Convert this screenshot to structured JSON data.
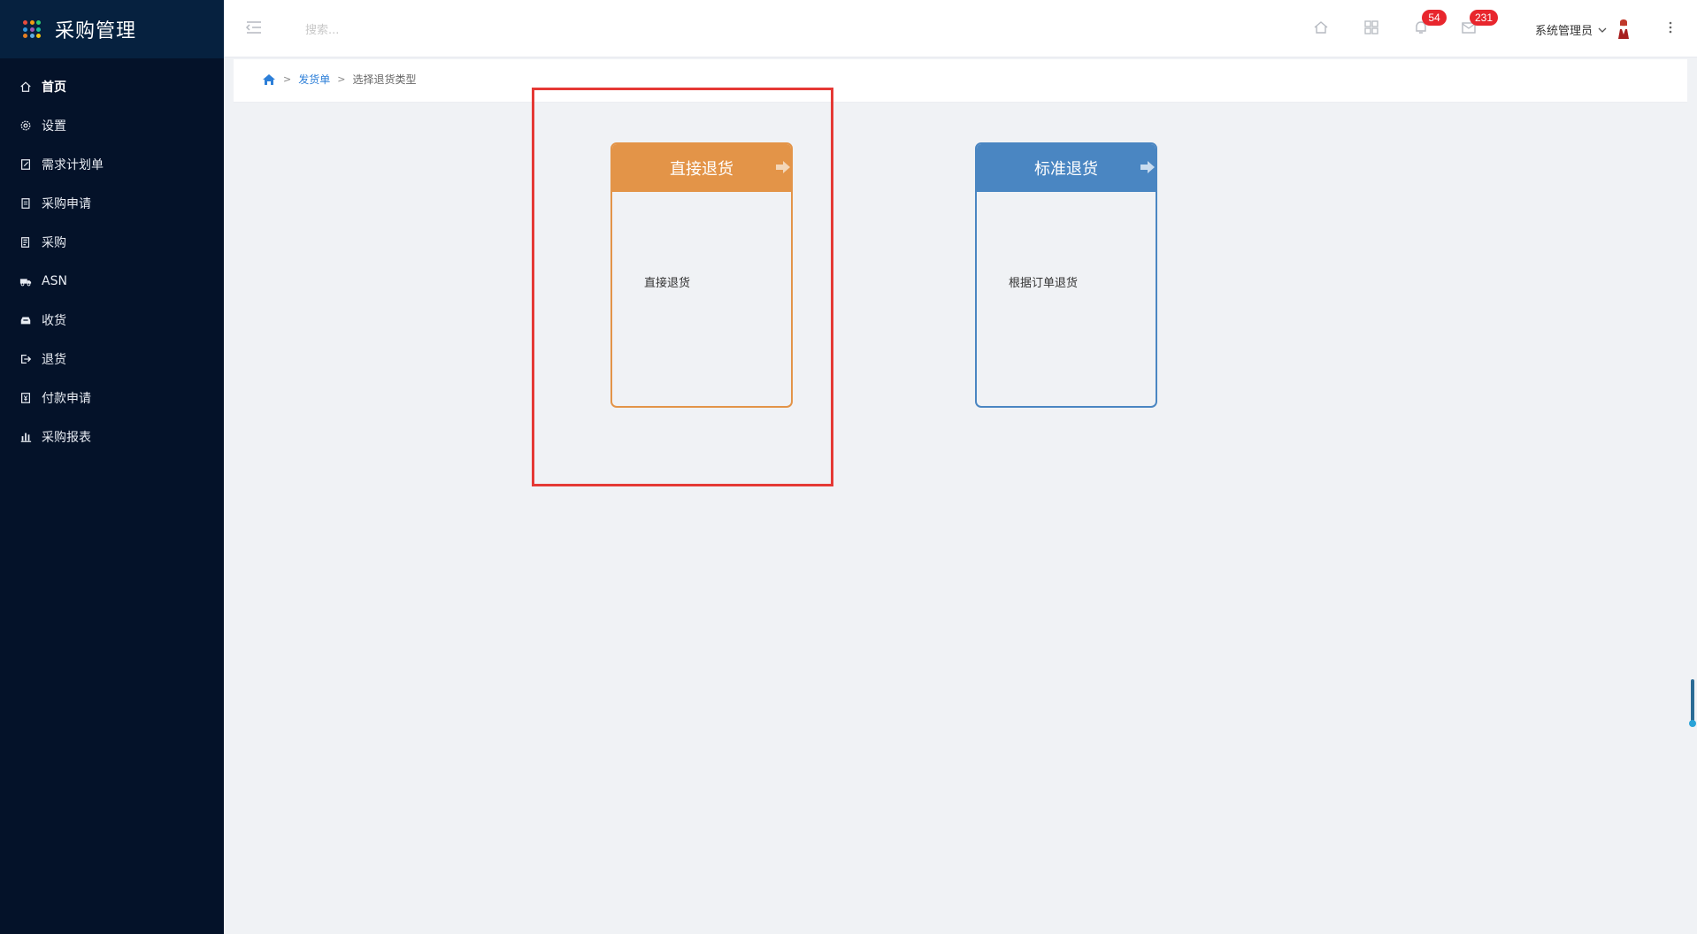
{
  "app": {
    "title": "采购管理",
    "brand_dot_colors": [
      "#e84c3d",
      "#f39c12",
      "#2ecc71",
      "#3498db",
      "#9b59b6",
      "#1abc9c",
      "#e67e22",
      "#5dade2",
      "#f1c40f"
    ]
  },
  "sidebar": {
    "items": [
      {
        "label": "首页",
        "icon": "home-icon"
      },
      {
        "label": "设置",
        "icon": "gear-icon"
      },
      {
        "label": "需求计划单",
        "icon": "document-edit-icon"
      },
      {
        "label": "采购申请",
        "icon": "document-icon"
      },
      {
        "label": "采购",
        "icon": "receipt-icon"
      },
      {
        "label": "ASN",
        "icon": "truck-icon"
      },
      {
        "label": "收货",
        "icon": "inbox-icon"
      },
      {
        "label": "退货",
        "icon": "exit-icon"
      },
      {
        "label": "付款申请",
        "icon": "payment-doc-icon"
      },
      {
        "label": "采购报表",
        "icon": "bar-chart-icon"
      }
    ]
  },
  "topbar": {
    "search_placeholder": "搜索...",
    "notifications_count": "54",
    "messages_count": "231",
    "user_name": "系统管理员"
  },
  "breadcrumb": {
    "parent": "发货单",
    "current": "选择退货类型"
  },
  "cards": {
    "direct": {
      "title": "直接退货",
      "description": "直接退货"
    },
    "standard": {
      "title": "标准退货",
      "description": "根据订单退货"
    }
  },
  "colors": {
    "sidebar_bg": "#041229",
    "direct_accent": "#e39448",
    "standard_accent": "#4a86c2",
    "highlight": "#e53935",
    "badge": "#e8262d"
  }
}
